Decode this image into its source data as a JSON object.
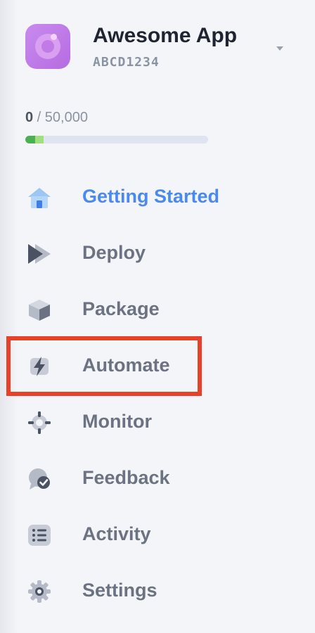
{
  "app": {
    "name": "Awesome App",
    "id": "ABCD1234"
  },
  "usage": {
    "used": "0",
    "separator": " / ",
    "limit": "50,000",
    "fill_fraction": 0.1
  },
  "colors": {
    "accent": "#4a8af0",
    "highlight": "#e8412a",
    "logo": "#c27ae6",
    "usage_green": "#4caf50",
    "usage_light_green": "#9ee07a"
  },
  "nav": {
    "items": [
      {
        "label": "Getting Started",
        "icon": "house-icon",
        "active": true
      },
      {
        "label": "Deploy",
        "icon": "play-forward-icon"
      },
      {
        "label": "Package",
        "icon": "box-icon"
      },
      {
        "label": "Automate",
        "icon": "lightning-icon",
        "highlighted": true
      },
      {
        "label": "Monitor",
        "icon": "crosshair-icon"
      },
      {
        "label": "Feedback",
        "icon": "chat-check-icon"
      },
      {
        "label": "Activity",
        "icon": "list-icon"
      },
      {
        "label": "Settings",
        "icon": "gear-icon"
      }
    ]
  }
}
